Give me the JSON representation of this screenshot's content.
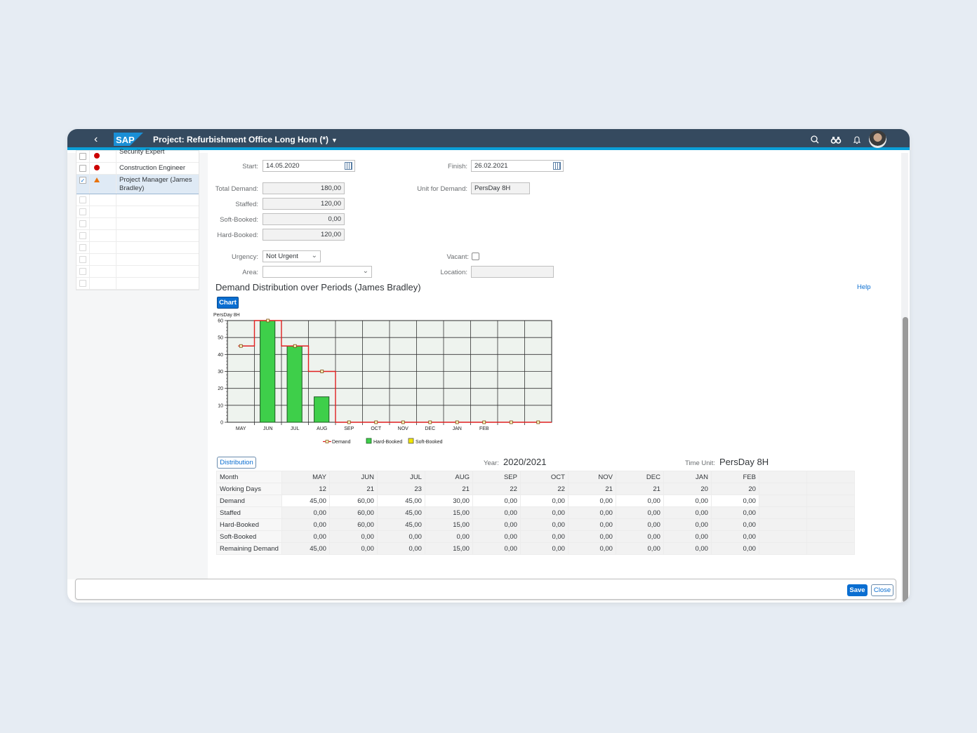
{
  "shell": {
    "title": "Project: Refurbishment Office Long Horn (*)",
    "logo_text": "SAP",
    "icons": [
      "back-icon",
      "search-icon",
      "binoculars-icon",
      "bell-icon",
      "avatar"
    ]
  },
  "roles": {
    "rows": [
      {
        "checked": false,
        "status": "red-dot",
        "label": "Security Expert"
      },
      {
        "checked": false,
        "status": "red-dot",
        "label": "Construction Engineer"
      },
      {
        "checked": true,
        "status": "warning-triangle",
        "label": "Project Manager (James Bradley)"
      }
    ],
    "empty_rows": 8
  },
  "form": {
    "start_label": "Start:",
    "start_value": "14.05.2020",
    "finish_label": "Finish:",
    "finish_value": "26.02.2021",
    "total_demand_label": "Total Demand:",
    "total_demand_value": "180,00",
    "unit_label": "Unit for Demand:",
    "unit_value": "PersDay 8H",
    "staffed_label": "Staffed:",
    "staffed_value": "120,00",
    "soft_booked_label": "Soft-Booked:",
    "soft_booked_value": "0,00",
    "hard_booked_label": "Hard-Booked:",
    "hard_booked_value": "120,00",
    "urgency_label": "Urgency:",
    "urgency_value": "Not Urgent",
    "vacant_label": "Vacant:",
    "vacant_checked": false,
    "area_label": "Area:",
    "area_value": "",
    "location_label": "Location:",
    "location_value": ""
  },
  "section": {
    "title": "Demand Distribution over Periods (James Bradley)",
    "help_label": "Help",
    "chart_button": "Chart",
    "distribution_button": "Distribution",
    "year_label": "Year:",
    "year_value": "2020/2021",
    "time_unit_label": "Time Unit:",
    "time_unit_value": "PersDay 8H"
  },
  "chart_data": {
    "type": "bar",
    "ylabel": "PersDay 8H",
    "ylim": [
      0,
      60
    ],
    "yticks": [
      0,
      10,
      20,
      30,
      40,
      50,
      60
    ],
    "categories": [
      "MAY",
      "JUN",
      "JUL",
      "AUG",
      "SEP",
      "OCT",
      "NOV",
      "DEC",
      "JAN",
      "FEB",
      "",
      ""
    ],
    "series": [
      {
        "name": "Demand",
        "kind": "step-line",
        "color": "#e02020",
        "values": [
          45,
          60,
          45,
          30,
          0,
          0,
          0,
          0,
          0,
          0,
          0,
          0
        ]
      },
      {
        "name": "Hard-Booked",
        "kind": "bar",
        "color": "#3ecf4a",
        "values": [
          0,
          60,
          45,
          15,
          0,
          0,
          0,
          0,
          0,
          0,
          0,
          0
        ]
      },
      {
        "name": "Soft-Booked",
        "kind": "bar",
        "color": "#f2e600",
        "values": [
          0,
          0,
          0,
          0,
          0,
          0,
          0,
          0,
          0,
          0,
          0,
          0
        ]
      }
    ],
    "legend_position": "bottom",
    "grid": true
  },
  "table": {
    "columns": [
      "Month",
      "MAY",
      "JUN",
      "JUL",
      "AUG",
      "SEP",
      "OCT",
      "NOV",
      "DEC",
      "JAN",
      "FEB"
    ],
    "rows": [
      {
        "label": "Working Days",
        "values": [
          "12",
          "21",
          "23",
          "21",
          "22",
          "22",
          "21",
          "21",
          "20",
          "20"
        ]
      },
      {
        "label": "Demand",
        "values": [
          "45,00",
          "60,00",
          "45,00",
          "30,00",
          "0,00",
          "0,00",
          "0,00",
          "0,00",
          "0,00",
          "0,00"
        ]
      },
      {
        "label": "Staffed",
        "values": [
          "0,00",
          "60,00",
          "45,00",
          "15,00",
          "0,00",
          "0,00",
          "0,00",
          "0,00",
          "0,00",
          "0,00"
        ]
      },
      {
        "label": "Hard-Booked",
        "values": [
          "0,00",
          "60,00",
          "45,00",
          "15,00",
          "0,00",
          "0,00",
          "0,00",
          "0,00",
          "0,00",
          "0,00"
        ]
      },
      {
        "label": "Soft-Booked",
        "values": [
          "0,00",
          "0,00",
          "0,00",
          "0,00",
          "0,00",
          "0,00",
          "0,00",
          "0,00",
          "0,00",
          "0,00"
        ]
      },
      {
        "label": "Remaining Demand",
        "values": [
          "45,00",
          "0,00",
          "0,00",
          "15,00",
          "0,00",
          "0,00",
          "0,00",
          "0,00",
          "0,00",
          "0,00"
        ]
      }
    ],
    "pager": [
      "|<",
      "<<",
      "<",
      ">",
      ">>",
      ">|"
    ]
  },
  "footer": {
    "save_label": "Save",
    "close_label": "Close"
  }
}
